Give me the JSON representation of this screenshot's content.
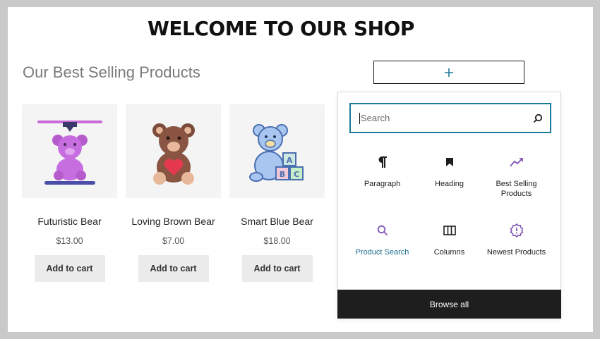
{
  "page": {
    "title": "WELCOME TO OUR SHOP",
    "section_heading": "Our Best Selling Products"
  },
  "products": [
    {
      "name": "Futuristic Bear",
      "price": "$13.00",
      "button": "Add to cart",
      "image": "purple-bear-icon"
    },
    {
      "name": "Loving Brown Bear",
      "price": "$7.00",
      "button": "Add to cart",
      "image": "brown-bear-heart-icon"
    },
    {
      "name": "Smart Blue Bear",
      "price": "$18.00",
      "button": "Add to cart",
      "image": "blue-bear-blocks-icon"
    }
  ],
  "add_block": {
    "icon": "plus-icon"
  },
  "inserter": {
    "search_placeholder": "Search",
    "search_icon": "search-icon",
    "blocks": [
      {
        "label": "Paragraph",
        "icon": "paragraph-icon",
        "active": false
      },
      {
        "label": "Heading",
        "icon": "bookmark-icon",
        "active": false
      },
      {
        "label": "Best Selling Products",
        "icon": "trend-icon",
        "active": false
      },
      {
        "label": "Product Search",
        "icon": "search-icon",
        "active": true
      },
      {
        "label": "Columns",
        "icon": "columns-icon",
        "active": false
      },
      {
        "label": "Newest Products",
        "icon": "badge-icon",
        "active": false
      }
    ],
    "browse_all": "Browse all"
  },
  "colors": {
    "accent": "#1c7a9a",
    "woo_purple": "#7f54b3",
    "dark": "#1e1e1e"
  }
}
